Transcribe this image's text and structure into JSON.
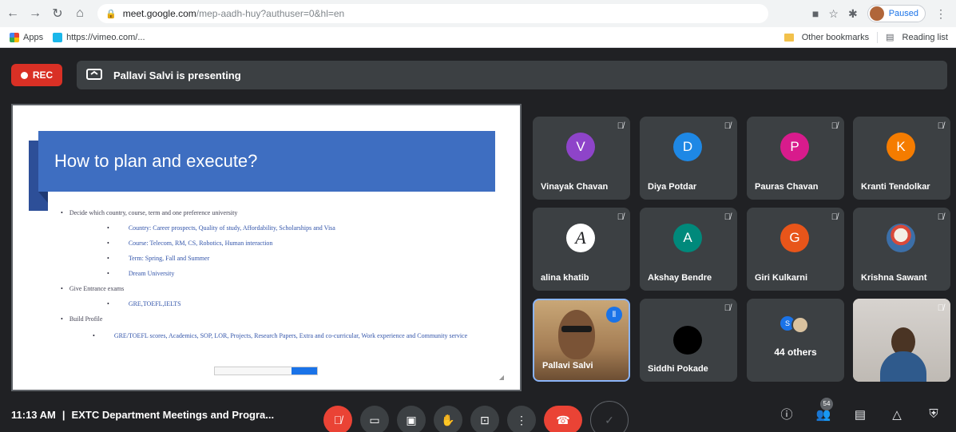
{
  "browser": {
    "url_host": "meet.google.com",
    "url_rest": "/mep-aadh-huy?authuser=0&hl=en",
    "profile_label": "Paused",
    "bookmarks": {
      "apps": "Apps",
      "vimeo": "https://vimeo.com/...",
      "other": "Other bookmarks",
      "reading": "Reading list"
    }
  },
  "meet": {
    "rec_label": "REC",
    "presenting_text": "Pallavi Salvi is presenting",
    "slide": {
      "title": "How to plan and execute?",
      "bullets": [
        {
          "level": 1,
          "text": "Decide which country, course, term and one preference university"
        },
        {
          "level": 2,
          "text": "Country: Career prospects, Quality of study, Affordability, Scholarships and Visa"
        },
        {
          "level": 2,
          "text": "Course: Telecom, RM, CS, Robotics, Human interaction"
        },
        {
          "level": 2,
          "text": "Term: Spring, Fall and Summer"
        },
        {
          "level": 2,
          "text": "Dream University"
        },
        {
          "level": 1,
          "text": "Give Entrance exams"
        },
        {
          "level": 2,
          "text": "GRE,TOEFL,IELTS"
        },
        {
          "level": 1,
          "text": "Build Profile"
        },
        {
          "level": 2,
          "text": "GRE/TOEFL scores, Academics, SOP, LOR, Projects, Research Papers, Extra and co-curricular, Work experience and Community service"
        }
      ]
    },
    "tiles": [
      {
        "name": "Vinayak Chavan",
        "initial": "V",
        "color": "#8e44c9"
      },
      {
        "name": "Diya Potdar",
        "initial": "D",
        "color": "#1e88e5"
      },
      {
        "name": "Pauras Chavan",
        "initial": "P",
        "color": "#d81b8c"
      },
      {
        "name": "Kranti Tendolkar",
        "initial": "K",
        "color": "#f57c00"
      },
      {
        "name": "alina khatib",
        "initial": "A",
        "color": "#ffffff"
      },
      {
        "name": "Akshay Bendre",
        "initial": "A",
        "color": "#00897b"
      },
      {
        "name": "Giri Kulkarni",
        "initial": "G",
        "color": "#e8551a"
      },
      {
        "name": "Krishna Sawant",
        "initial": "",
        "color": "#5c7a99"
      },
      {
        "name": "Pallavi Salvi",
        "initial": "",
        "color": ""
      },
      {
        "name": "Siddhi Pokade",
        "initial": "",
        "color": "#000000"
      },
      {
        "name": "44 others",
        "initial": "S",
        "color": "#1a73e8"
      }
    ],
    "bottom": {
      "time": "11:13 AM",
      "separator": "|",
      "meeting_title": "EXTC Department Meetings and Progra...",
      "participants_count": "54"
    }
  }
}
